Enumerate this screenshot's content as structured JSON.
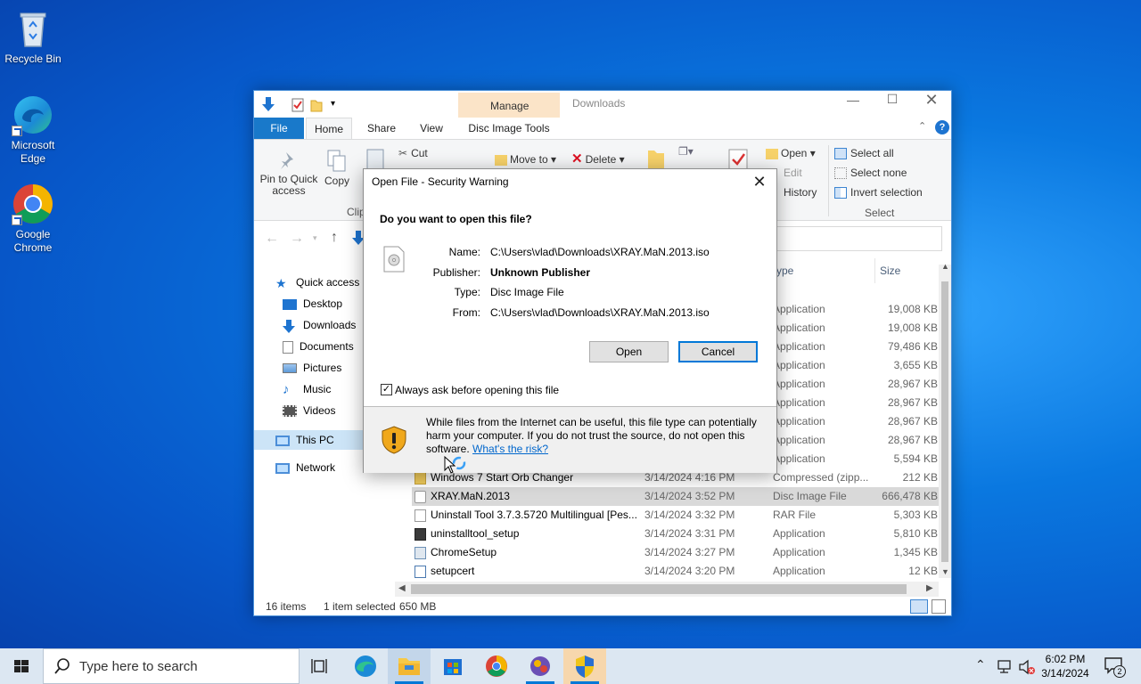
{
  "desktop": {
    "icons": [
      {
        "label": "Recycle Bin"
      },
      {
        "label": "Microsoft Edge"
      },
      {
        "label": "Google Chrome"
      }
    ]
  },
  "explorer": {
    "context_tab_group": "Manage",
    "title": "Downloads",
    "tabs": {
      "file": "File",
      "home": "Home",
      "share": "Share",
      "view": "View",
      "disc_image_tools": "Disc Image Tools"
    },
    "ribbon": {
      "pin": "Pin to Quick access",
      "copy": "Copy",
      "clipboard_group": "Clip",
      "cut": "Cut",
      "move_to": "Move to",
      "delete": "Delete",
      "open": "Open",
      "edit": "Edit",
      "history": "History",
      "select_all": "Select all",
      "select_none": "Select none",
      "invert_selection": "Invert selection",
      "select_group": "Select"
    },
    "nav": {
      "quick_access": "Quick access",
      "desktop": "Desktop",
      "downloads": "Downloads",
      "documents": "Documents",
      "pictures": "Pictures",
      "music": "Music",
      "videos": "Videos",
      "this_pc": "This PC",
      "network": "Network"
    },
    "columns": {
      "type": "ype",
      "size": "Size"
    },
    "hidden_rows": [
      {
        "type": "Application",
        "size": "19,008 KB"
      },
      {
        "type": "Application",
        "size": "19,008 KB"
      },
      {
        "type": "Application",
        "size": "79,486 KB"
      },
      {
        "type": "Application",
        "size": "3,655 KB"
      },
      {
        "type": "Application",
        "size": "28,967 KB"
      },
      {
        "type": "Application",
        "size": "28,967 KB"
      },
      {
        "type": "Application",
        "size": "28,967 KB"
      },
      {
        "type": "Application",
        "size": "28,967 KB"
      },
      {
        "type": "Application",
        "size": "5,594 KB"
      }
    ],
    "rows": [
      {
        "name": "Windows 7 Start Orb Changer",
        "date": "3/14/2024 4:16 PM",
        "type": "Compressed (zipp...",
        "size": "212 KB"
      },
      {
        "name": "XRAY.MaN.2013",
        "date": "3/14/2024 3:52 PM",
        "type": "Disc Image File",
        "size": "666,478 KB"
      },
      {
        "name": "Uninstall Tool 3.7.3.5720 Multilingual [Pes...",
        "date": "3/14/2024 3:32 PM",
        "type": "RAR File",
        "size": "5,303 KB"
      },
      {
        "name": "uninstalltool_setup",
        "date": "3/14/2024 3:31 PM",
        "type": "Application",
        "size": "5,810 KB"
      },
      {
        "name": "ChromeSetup",
        "date": "3/14/2024 3:27 PM",
        "type": "Application",
        "size": "1,345 KB"
      },
      {
        "name": "setupcert",
        "date": "3/14/2024 3:20 PM",
        "type": "Application",
        "size": "12 KB"
      }
    ],
    "status": {
      "items": "16 items",
      "selected": "1 item selected",
      "size": "650 MB"
    }
  },
  "dialog": {
    "title": "Open File - Security Warning",
    "prompt": "Do you want to open this file?",
    "fields": [
      {
        "label": "Name:",
        "value": "C:\\Users\\vlad\\Downloads\\XRAY.MaN.2013.iso"
      },
      {
        "label": "Publisher:",
        "value": "Unknown Publisher"
      },
      {
        "label": "Type:",
        "value": "Disc Image File"
      },
      {
        "label": "From:",
        "value": "C:\\Users\\vlad\\Downloads\\XRAY.MaN.2013.iso"
      }
    ],
    "open_button": "Open",
    "cancel_button": "Cancel",
    "checkbox_label": "Always ask before opening this file",
    "checkbox_checked": true,
    "warning_text": "While files from the Internet can be useful, this file type can potentially harm your computer. If you do not trust the source, do not open this software.",
    "risk_link": "What's the risk?"
  },
  "taskbar": {
    "search_placeholder": "Type here to search",
    "time": "6:02 PM",
    "date": "3/14/2024",
    "notification_count": "2"
  },
  "colors": {
    "accent": "#0078d7",
    "file_tab": "#1979ca",
    "manage_band": "#fbe4c8"
  }
}
